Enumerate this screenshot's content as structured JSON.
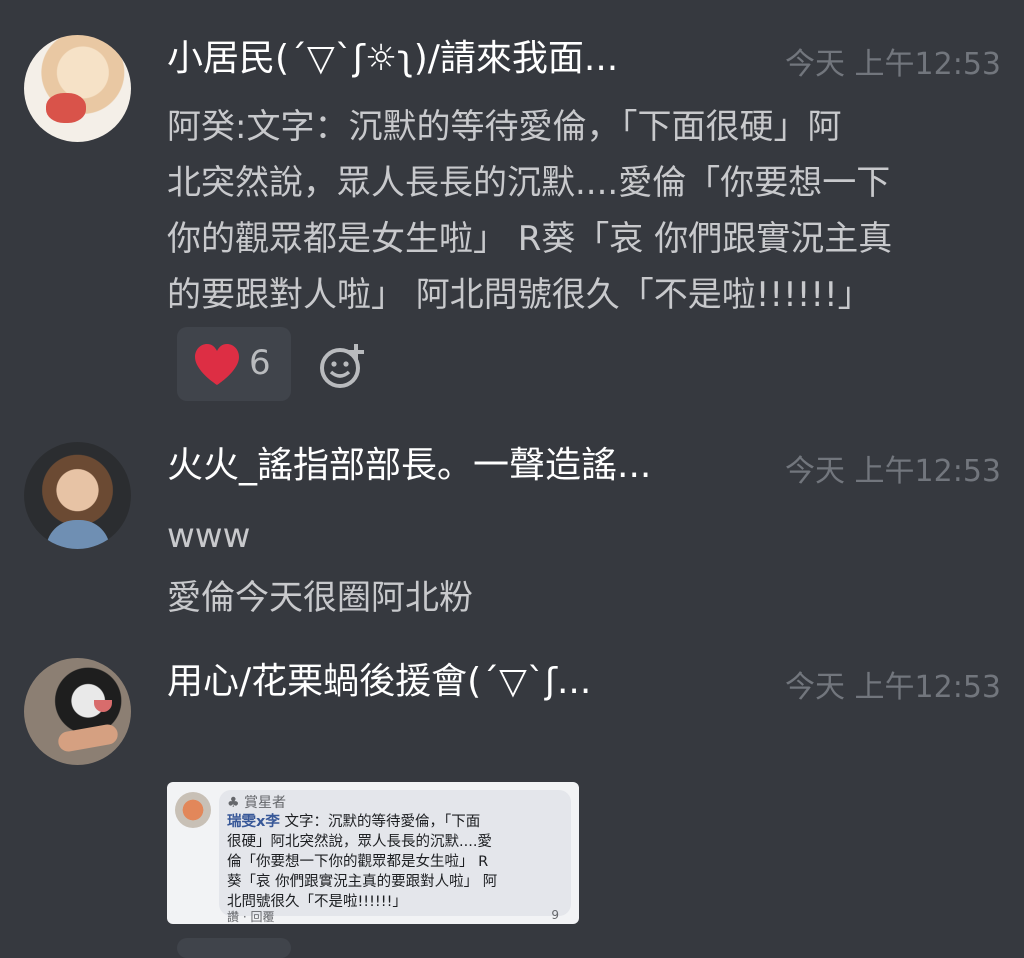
{
  "messages": [
    {
      "author": "小居民(´▽`ʃ☼ʅ)/請來我面...",
      "time": "今天 上午12:53",
      "lines": [
        "阿癸:文字：沉默的等待愛倫，「下面很硬」阿",
        "北突然說，眾人長長的沉默....愛倫「你要想一下",
        "你的觀眾都是女生啦」 R葵「哀 你們跟實況主真",
        "的要跟對人啦」 阿北問號很久「不是啦!!!!!!」"
      ],
      "reaction": {
        "icon": "heart-icon",
        "count": "6",
        "color": "#dd2e44"
      }
    },
    {
      "author": "火火_謠指部部長。一聲造謠...",
      "time": "今天 上午12:53",
      "lines": [
        "www",
        "愛倫今天很圈阿北粉"
      ]
    },
    {
      "author": "用心/花栗蝸後援會(´▽`ʃ...",
      "time": "今天 上午12:53",
      "attachment": {
        "role": "♣ 賞星者",
        "author": "瑞雯x李",
        "lines": [
          "文字：沉默的等待愛倫，「下面",
          "很硬」阿北突然說，眾人長長的沉默....愛",
          "倫「你要想一下你的觀眾都是女生啦」 R",
          "葵「哀 你們跟實況主真的要跟對人啦」 阿",
          "北問號很久「不是啦!!!!!!」"
        ],
        "footer": "讚 · 回覆",
        "reaction_count": "9"
      }
    }
  ]
}
